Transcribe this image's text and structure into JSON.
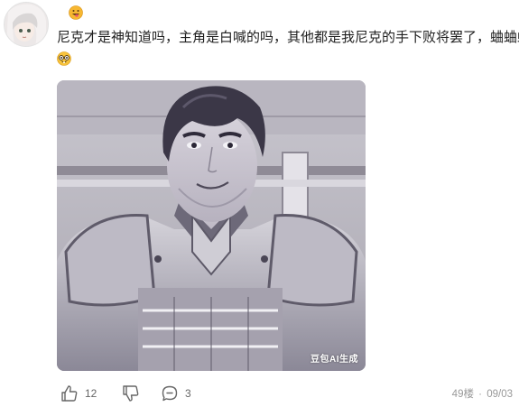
{
  "comment": {
    "text": "尼克才是神知道吗，主角是白喊的吗，其他都是我尼克的手下败将罢了，蛐蛐蛐蛐",
    "inline_emoji": "nerd-face-emoji",
    "badge_emoji": "grinning-tongue-emoji"
  },
  "image": {
    "watermark": "豆包AI生成",
    "description_colors": {
      "tone": "#8f8c99"
    }
  },
  "actions": {
    "like_count": "12",
    "comment_count": "3"
  },
  "meta": {
    "floor": "49楼",
    "separator": "·",
    "date": "09/03"
  }
}
